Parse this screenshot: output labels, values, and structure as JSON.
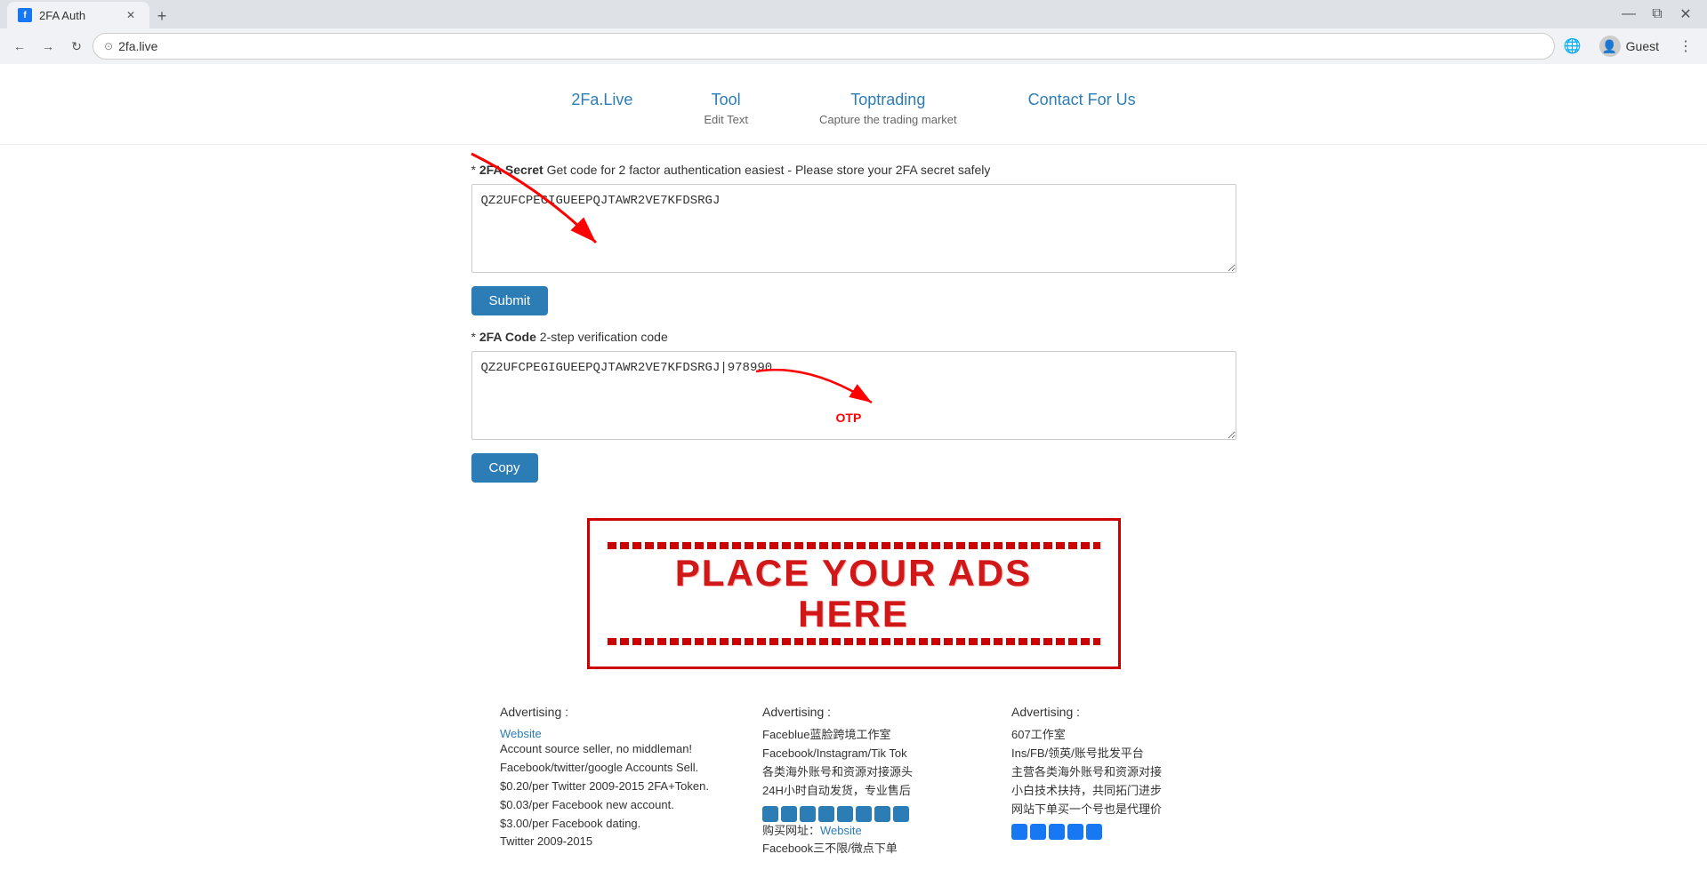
{
  "browser": {
    "tab_title": "2FA Auth",
    "tab_favicon": "f",
    "new_tab_label": "+",
    "back_label": "←",
    "forward_label": "→",
    "reload_label": "↻",
    "address": "2fa.live",
    "translate_icon": "🌐",
    "profile_label": "Guest",
    "more_icon": "⋮"
  },
  "nav": {
    "items": [
      {
        "id": "home",
        "title": "2Fa.Live",
        "subtitle": ""
      },
      {
        "id": "tool",
        "title": "Tool",
        "subtitle": "Edit Text"
      },
      {
        "id": "toptrading",
        "title": "Toptrading",
        "subtitle": "Capture the trading market"
      },
      {
        "id": "contact",
        "title": "Contact For Us",
        "subtitle": ""
      }
    ]
  },
  "main": {
    "secret_label_bold": "2FA Secret",
    "secret_label_text": " Get code for 2 factor authentication easiest - Please store your 2FA secret safely",
    "secret_value": "QZ2UFCPEGIGUEEPQJTAWR2VE7KFDSRGJ",
    "submit_label": "Submit",
    "code_label_bold": "2FA Code",
    "code_label_text": " 2-step verification code",
    "code_value": "QZ2UFCPEGIGUEEPQJTAWR2VE7KFDSRGJ|978990",
    "otp_label": "OTP",
    "copy_label": "Copy"
  },
  "ads": {
    "line1": "PLACE YOUR ADS",
    "line2": "HERE"
  },
  "footer": {
    "columns": [
      {
        "title": "Advertising :",
        "link_text": "Website",
        "lines": [
          "Account source seller, no middleman!",
          "Facebook/twitter/google Accounts Sell.",
          "$0.20/per Twitter 2009-2015 2FA+Token.",
          "$0.03/per Facebook new account.",
          "$3.00/per Facebook dating.",
          "Twitter 2009-2015"
        ]
      },
      {
        "title": "Advertising :",
        "link_text": "",
        "lines": [
          "Faceblue蓝脸跨境工作室",
          "Facebook/Instagram/Tik Tok",
          "各类海外账号和资源对接源头",
          "24H小时自动发货，专业售后",
          "购买网址：Website",
          "Facebook三不限/微点下单"
        ]
      },
      {
        "title": "Advertising :",
        "link_text": "",
        "lines": [
          "607工作室",
          "",
          "Ins/FB/领英/账号批发平台",
          "主营各类海外账号和资源对接",
          "小白技术扶持，共同拓门进步",
          "网站下单买一个号也是代理价"
        ]
      }
    ]
  }
}
